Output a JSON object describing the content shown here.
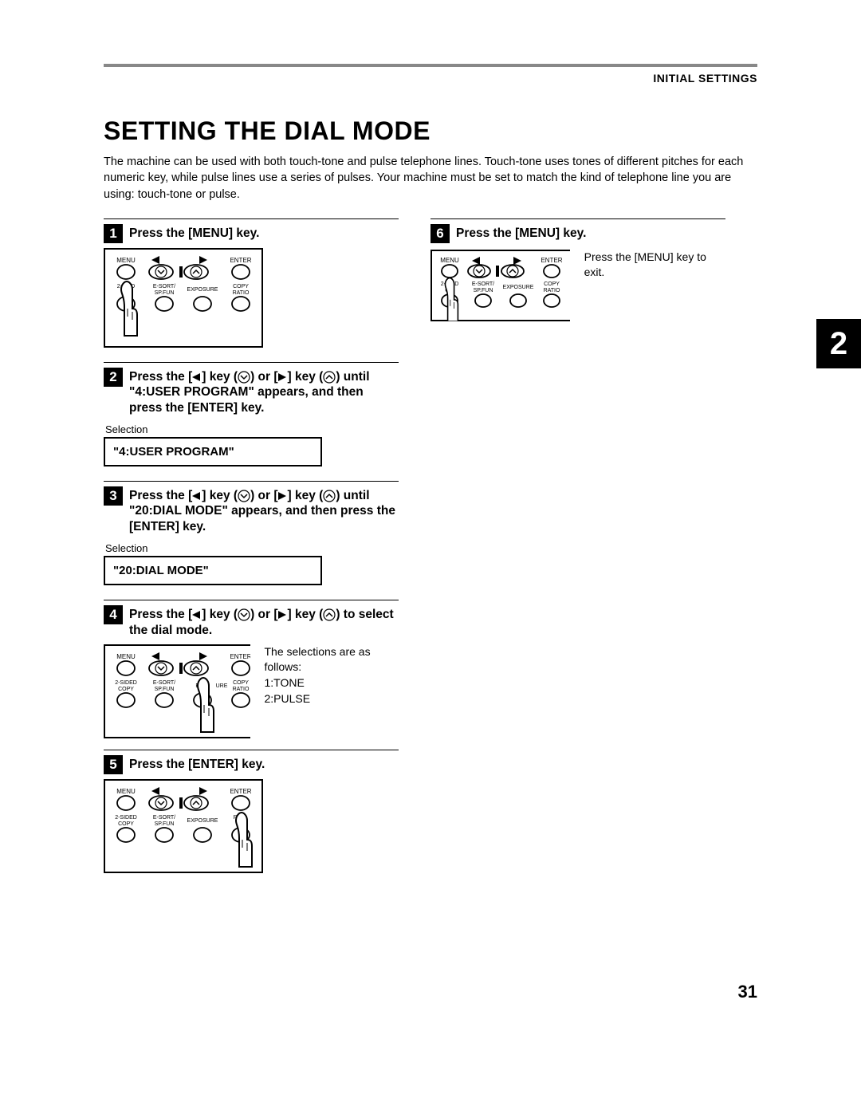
{
  "header": {
    "section_title": "INITIAL SETTINGS"
  },
  "page": {
    "title": "SETTING THE DIAL MODE",
    "intro": "The machine can be used with both touch-tone and pulse telephone lines. Touch-tone uses tones of different pitches for each numeric key, while pulse lines use a series of pulses. Your machine must be set to match the kind of telephone line you are using: touch-tone or pulse.",
    "tab_number": "2",
    "page_number": "31"
  },
  "panel_labels": {
    "menu": "MENU",
    "enter": "ENTER",
    "twosided": "2-SIDED",
    "copy_small": "COPY",
    "esort_spfun": "E-SORT/\nSP.FUN",
    "exposure": "EXPOSURE",
    "copy_ratio": "COPY\nRATIO",
    "twosided_copy_a": "2-SIDED\nCOPY",
    "esort_spfun_b": "E-SORT/\nSP.FUN",
    "exposure_b": "EXPOSURE",
    "ex_ure_ratio": "EX   URE RATIO"
  },
  "steps": {
    "s1": {
      "num": "1",
      "title": "Press the [MENU] key."
    },
    "s2": {
      "num": "2",
      "title_prefix": "Press the [",
      "title_mid1": "] key (",
      "title_mid2": ") or [",
      "title_mid3": "] key (",
      "title_suffix": ") until \"4:USER PROGRAM\" appears, and then press the [ENTER] key.",
      "selection_label": "Selection",
      "display": "\"4:USER PROGRAM\""
    },
    "s3": {
      "num": "3",
      "title_prefix": "Press the [",
      "title_mid1": "] key (",
      "title_mid2": ") or [",
      "title_mid3": "] key (",
      "title_suffix": ") until \"20:DIAL MODE\" appears, and then press the [ENTER] key.",
      "selection_label": "Selection",
      "display": "\"20:DIAL MODE\""
    },
    "s4": {
      "num": "4",
      "title_prefix": "Press the [",
      "title_mid1": "] key (",
      "title_mid2": ") or [",
      "title_mid3": "] key (",
      "title_suffix": ") to select the dial mode.",
      "side_text": "The selections are as follows:\n1:TONE\n2:PULSE"
    },
    "s5": {
      "num": "5",
      "title": "Press the [ENTER] key."
    },
    "s6": {
      "num": "6",
      "title": "Press the [MENU] key.",
      "side_text": "Press the [MENU] key to exit."
    }
  }
}
